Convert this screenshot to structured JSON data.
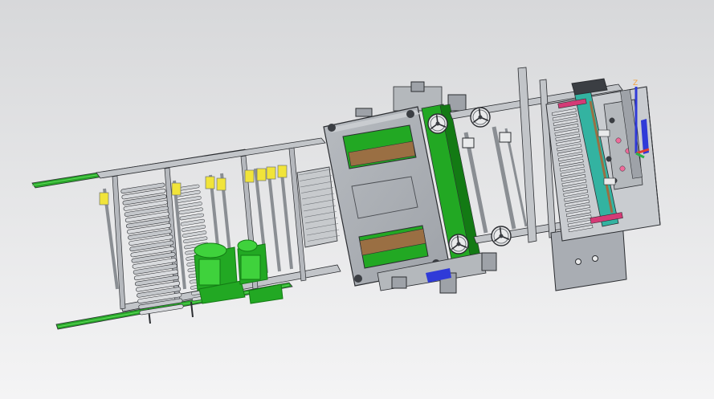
{
  "viewport": {
    "background_top": "#d7d8da",
    "background_bottom": "#f4f4f5",
    "view": "isometric"
  },
  "palette": {
    "steel": "#a9adb3",
    "steel_dark": "#6d7176",
    "steel_light": "#c9ccd0",
    "outline": "#2b2d31",
    "green": "#22a823",
    "green_bright": "#3fd23c",
    "green_dark": "#137a14",
    "yellow": "#f1e43a",
    "brown": "#9a6f43",
    "teal": "#33b3a1",
    "magenta": "#d43b76",
    "pink": "#f06b9a",
    "blue": "#2f3ad8",
    "orange": "#f3a13c",
    "axis_x": "#e23d2e",
    "axis_y": "#27b24a",
    "axis_z": "#2f3ad8"
  },
  "triad": {
    "axes": [
      "x-axis",
      "y-axis",
      "z-axis"
    ],
    "z_label": "Z"
  },
  "model": {
    "name": "machine-assembly",
    "modules": [
      "infeed-rail",
      "roller-stack",
      "drive-motors",
      "press-unit",
      "handwheels",
      "outfeed-head"
    ]
  }
}
